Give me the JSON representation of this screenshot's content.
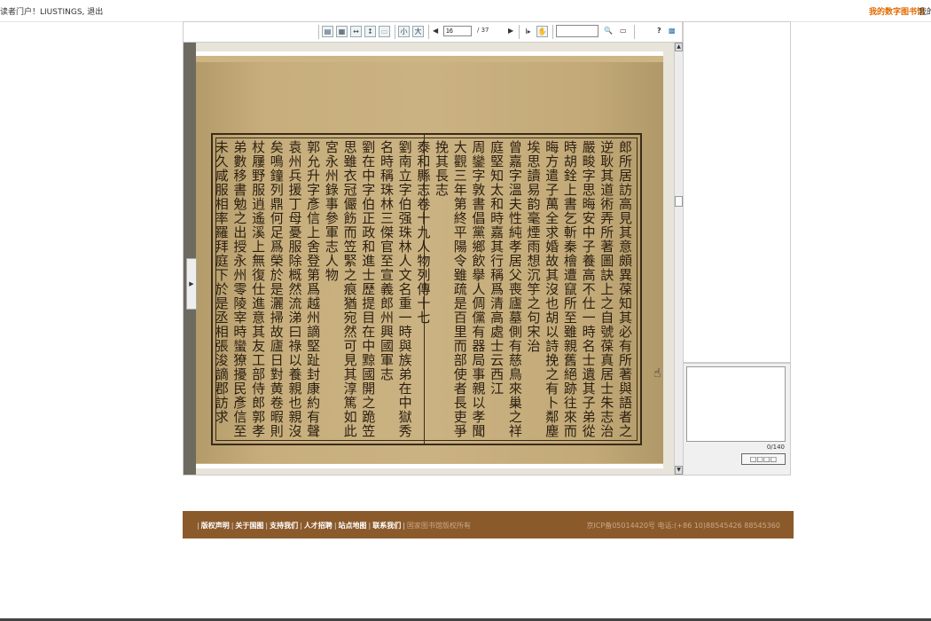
{
  "header": {
    "greeting": "读者门户！LIUSTINGS,",
    "logout": "退出",
    "my_library": "我的数字图书馆",
    "my_reading": "我的阅"
  },
  "toolbar": {
    "page_current": "16",
    "page_total": "/ 37",
    "small_label": "小",
    "large_label": "大"
  },
  "document": {
    "columns": [
      "郎所居訪高見其意頗異葆知其必有所著與語者之",
      "逆耿其道術弄所著圖訣上之自號葆真居士朱志治",
      "嚴畯字思晦安中子養高不仕一時名士遺其子弟從游",
      "時胡銓上書乞斬秦檜遭竄所至雖親舊絕跡往來而思",
      "晦方遣子萬全求婚故其沒也胡以詩挽之有卜鄰塵",
      "埃思讀易韵毫煙雨想沉竽之句宋治",
      "曾嘉字溫夫性純孝居父喪廬墓側有慈鳥來巢之祥黄",
      "庭堅知太和時嘉其行稱爲清高處士云西江",
      "周鑾字敦書倡黨鄉飲擧人倜儻有器局事親以孝聞登",
      "大觀三年第終平陽令雖疏是百里而部使者長吏爭",
      "挽其長志",
      "泰和縣志卷十九人物列傳十七",
      "劉南立字伯强珠林人文名重一時與族弟在中獄秀齊",
      "名時稱珠林三傑官至宣義郎州興國軍志",
      "劉在中字伯正政和進士歷提目在中黥國開之跪笠謝",
      "思雖衣冠儼飭而笠緊之痕猶宛然可見其淳篤如此",
      "宮永州錄事參軍志人物",
      "郭允升字彥信上舍登第爲越州謫堅趾封康約有聲攸",
      "袁州兵援丁母憂服除概然流涕曰祿以養親也親沒",
      "矣鳴鐘列鼎何足爲榮於是灑掃故廬日對黄卷暇則",
      "杖屨野服逍遙溪上無復仕進意其友工部侍郎郭孝",
      "弟數移書勉之出授永州零陵宰時蠻獠擾民彥信至",
      "未久咸服相率羅拜庭下於是丞相張浚謫郡訪求"
    ]
  },
  "note": {
    "count": "0/140",
    "submit_label": "□□□□"
  },
  "footer": {
    "links": [
      "版权声明",
      "关于国图",
      "支持我们",
      "人才招聘",
      "站点地图",
      "联系我们"
    ],
    "copyright": "国家图书馆版权所有",
    "icp": "京ICP备05014420号 电话:(+86 10)88545426 88545360"
  }
}
